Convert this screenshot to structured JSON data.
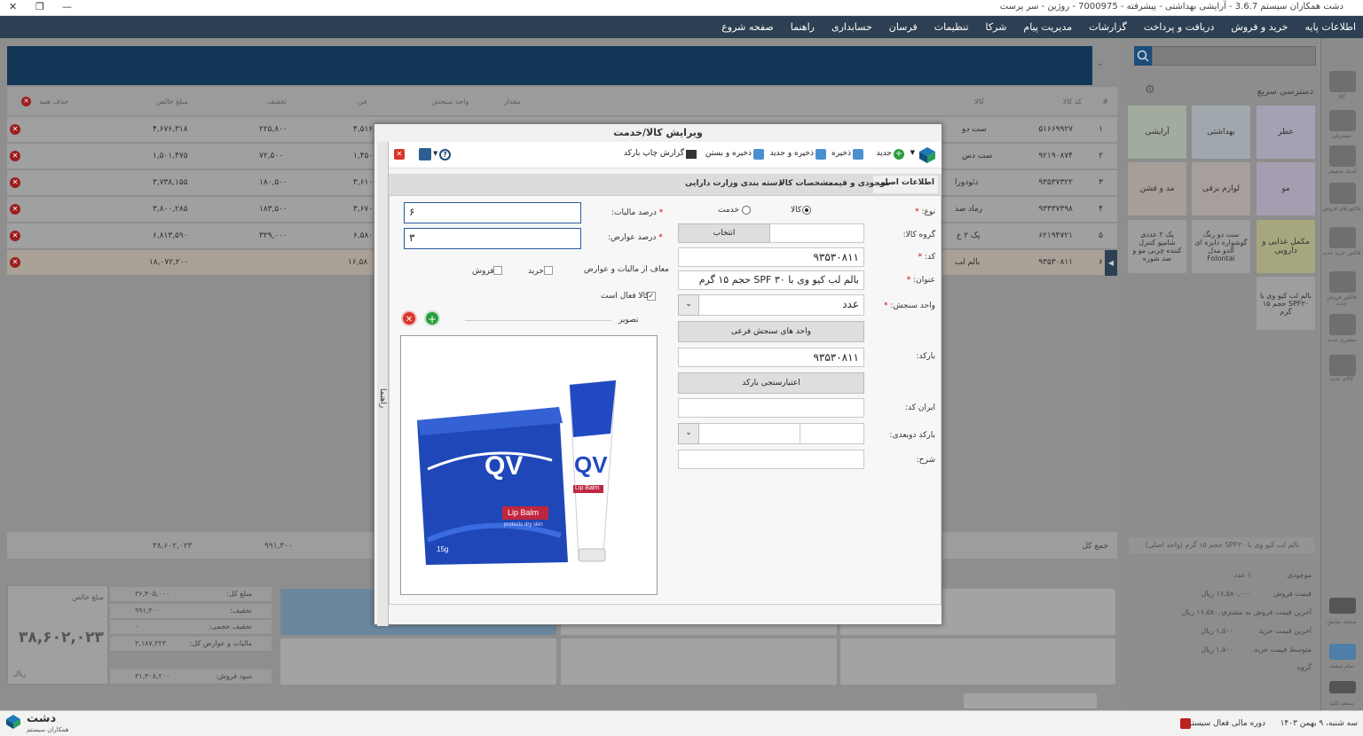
{
  "window": {
    "title": "دشت همکاران سیستم 3.6.7 - آرایشی بهداشتی - پیشرفته - 7000975 - روژین - سر پرست",
    "close": "✕",
    "restore": "❐",
    "minimize": "—"
  },
  "menu": [
    "اطلاعات پایه",
    "خرید و فروش",
    "دریافت و پرداخت",
    "گزارشات",
    "مدیریت پیام",
    "شرکا",
    "تنظیمات",
    "فرسان",
    "حسابداری",
    "راهنما",
    "صفحه شروع"
  ],
  "grid": {
    "headers": {
      "num": "#",
      "code": "کد کالا",
      "name": "کالا",
      "qty": "مقدار",
      "unit": "واحد سنجش",
      "fee": "فی",
      "discount": "تخفیف",
      "net": "مبلغ خالص",
      "deleteall": "حذف همه"
    },
    "rows": [
      {
        "n": "۱",
        "code": "۵۱۶۶۹۹۲۷",
        "name": "ست دو",
        "fee": "۴,۵۱۶",
        "discount": "۲۲۵,۸۰۰",
        "net": "۴,۶۷۶,۳۱۸"
      },
      {
        "n": "۲",
        "code": "۹۲۱۹۰۸۷۴",
        "name": "ست دس",
        "fee": "۱,۴۵۰",
        "discount": "۷۲,۵۰۰",
        "net": "۱,۵۰۱,۴۷۵"
      },
      {
        "n": "۳",
        "code": "۹۳۵۳۷۳۲۲",
        "name": "دئودورا",
        "fee": "۳,۶۱۰",
        "discount": "۱۸۰,۵۰۰",
        "net": "۳,۷۳۸,۱۵۵"
      },
      {
        "n": "۴",
        "code": "۹۳۳۳۷۳۹۸",
        "name": "رماد ضد",
        "fee": "۳,۶۷۰",
        "discount": "۱۸۳,۵۰۰",
        "net": "۳,۸۰۰,۲۸۵"
      },
      {
        "n": "۵",
        "code": "۶۲۱۹۴۷۲۱",
        "name": "پک ۲ ع",
        "fee": "۶,۵۸۰",
        "discount": "۳۲۹,۰۰۰",
        "net": "۶,۸۱۳,۵۹۰"
      },
      {
        "n": "۶",
        "code": "۹۳۵۳۰۸۱۱",
        "name": "بالم لب",
        "fee": "۱۶,۵۸",
        "discount": "",
        "net": "۱۸,۰۷۲,۲۰۰"
      }
    ],
    "total_label": "جمع کل",
    "total_fee": "۹۹۱,۳۰۰",
    "total_net": "۳۸,۶۰۲,۰۲۳"
  },
  "summary": {
    "net_label": "مبلغ خالص",
    "net_value": "۳۸,۶۰۲,۰۲۳",
    "currency": "ریال",
    "rows": [
      {
        "k": "مبلغ کل:",
        "v": "۳۶,۴۰۵,۰۰۰"
      },
      {
        "k": "تخفیف:",
        "v": "۹۹۱,۳۰۰"
      },
      {
        "k": "تخفیف حجمی:",
        "v": "۰"
      },
      {
        "k": "مالیات و عوارض کل:",
        "v": "۳,۱۸۷,۳۲۳"
      },
      {
        "k": "سود فروش:",
        "v": "۳۱,۳۰۸,۲۰۰"
      }
    ]
  },
  "right_panel": {
    "quick_access": "دسترسی سریع",
    "tiles": [
      "عطر",
      "بهداشتی",
      "آرایشی",
      "مو",
      "لوازم برقی",
      "مد و فشن",
      "مکمل غذایی و دارویی",
      "ست دو رنگ گوشواره دایره ای آلدو مدل Folontai",
      "پک ۲ عددی شامپو کنترل کننده چربی مو و ضد شوره",
      "بالم لب کیو وی با SPF۳۰ حجم ۱۵ گرم"
    ],
    "info_title": "بالم لب کیو وی با SPF۳۰ حجم ۱۵ گرم (واحد اصلی)",
    "info": [
      {
        "k": "موجودی",
        "v": "۱ عدد"
      },
      {
        "k": "قیمت فروش",
        "v": "۱۶,۵۸۰,۰۰۰ ریال"
      },
      {
        "k": "آخرین قیمت فروش به مشتری",
        "v": "۱۶,۵۸۰,۰۰۰ ریال"
      },
      {
        "k": "آخرین قیمت خرید",
        "v": "۱,۵۰۰ ریال"
      },
      {
        "k": "متوسط قیمت خرید",
        "v": "۱,۵۰۰ ریال"
      },
      {
        "k": "گروه",
        "v": ""
      }
    ]
  },
  "sidebar": [
    "کالا",
    "مشتریان",
    "اسناد تحقیقی",
    "فاکتورهای فروش",
    "فاکتور خرید جدید",
    "فاکتور فروش جدید",
    "مشتری جدید",
    "کالای جدید",
    "صفحه نمایش",
    "تمام صفحه",
    "صفحه کلید"
  ],
  "dialog": {
    "title": "ویرایش کالا/خدمت",
    "toolbar": {
      "new": "جدید",
      "save": "ذخیره",
      "save_new": "ذخیره و جدید",
      "save_close": "ذخیره و بستن",
      "print_barcode": "گزارش چاپ بارکد"
    },
    "tabs": [
      "اطلاعات اصلی",
      "موجودی و قیمت",
      "مشخصات کالا",
      "دسته بندی وزارت دارایی"
    ],
    "side_tab": "راهنما",
    "fields": {
      "type_label": "نوع:",
      "type_goods": "کالا",
      "type_service": "خدمت",
      "group_label": "گروه کالا:",
      "group_select": "انتخاب",
      "code_label": "کد:",
      "code_value": "۹۳۵۳۰۸۱۱",
      "title_label": "عنوان:",
      "title_value": "بالم لب کیو وی با ۳۰ SPF حجم ۱۵ گرم",
      "unit_label": "واحد سنجش:",
      "unit_value": "عدد",
      "sub_units": "واحد های سنجش فرعی",
      "barcode_label": "بارکد:",
      "barcode_value": "۹۳۵۳۰۸۱۱",
      "validate_barcode": "اعتبارسنجی بارکد",
      "iran_code_label": "ایران کد:",
      "barcode2d_label": "بارکد دوبعدی:",
      "description_label": "شرح:",
      "tax_label": "درصد مالیات:",
      "tax_value": "۶",
      "duty_label": "درصد عوارض:",
      "duty_value": "۳",
      "exempt_label": "معاف از مالیات و عوارض",
      "exempt_buy": "خرید",
      "exempt_sell": "فروش",
      "active_label": "کالا فعال است",
      "image_label": "تصویر"
    },
    "product_image": {
      "brand": "QV",
      "name": "Lip Balm",
      "sub": "protects dry skin",
      "size": "15g"
    }
  },
  "status": {
    "date": "سه شنبه، ۹ بهمن ۱۴۰۳",
    "fiscal": "دوره مالی فعال سیستم",
    "logo": "دشت",
    "logo_sub": "همکاران سیستم"
  },
  "colors": {
    "menubar": "#2d3f52",
    "banner": "#123656",
    "accent": "#1d4d7a"
  }
}
